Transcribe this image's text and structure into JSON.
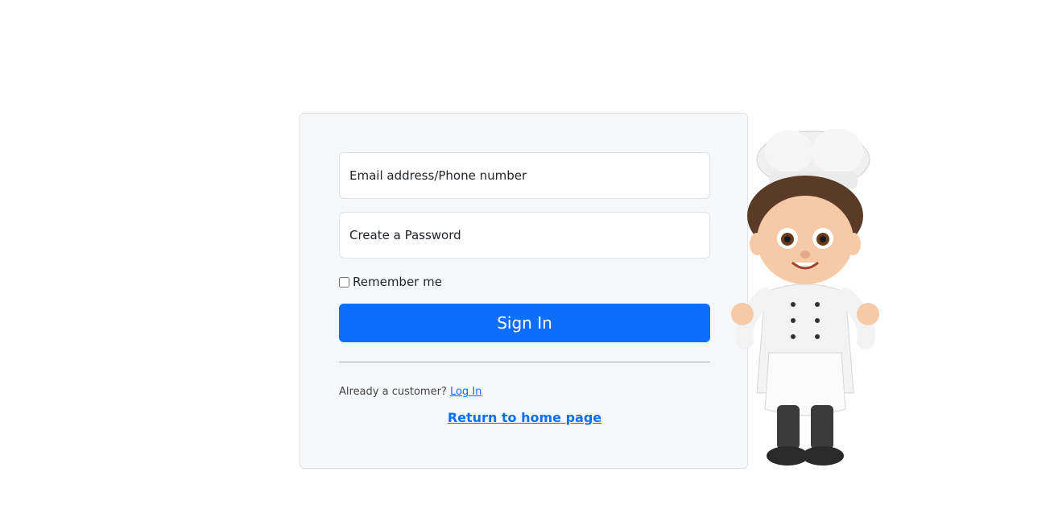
{
  "form": {
    "email_placeholder": "Email address/Phone number",
    "password_placeholder": "Create a Password",
    "remember_label": "Remember me",
    "signin_label": "Sign In",
    "already_text": "Already a customer?",
    "login_link": "Log In",
    "home_link": "Return to home page"
  },
  "colors": {
    "primary": "#0d6efd",
    "card_bg": "#f7f8fa"
  },
  "illustration": {
    "icon": "chef-mascot-icon"
  }
}
